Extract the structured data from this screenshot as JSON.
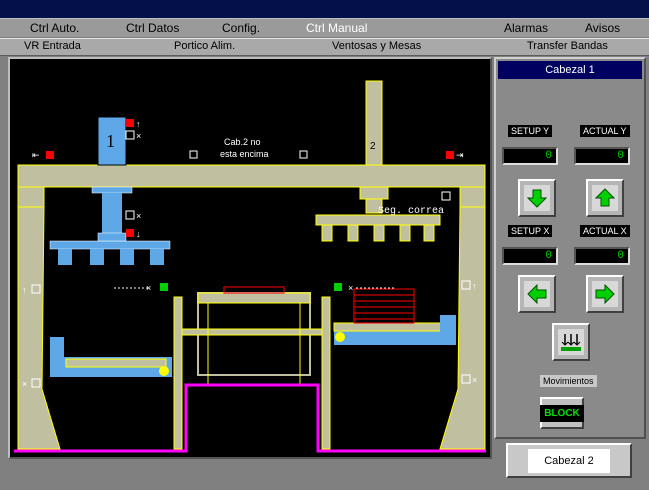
{
  "menu": {
    "items": [
      "Ctrl Auto.",
      "Ctrl Datos",
      "Config.",
      "Ctrl Manual",
      "Alarmas",
      "Avisos"
    ]
  },
  "submenu": {
    "items": [
      "VR  Entrada",
      "Portico  Alim.",
      "Ventosas y Mesas",
      "Transfer Bandas"
    ]
  },
  "canvas": {
    "head1_number": "1",
    "head2_number": "2",
    "message_line1": "Cab.2 no",
    "message_line2": "esta encima",
    "belt_label": "Seg. correa"
  },
  "panel": {
    "title": "Cabezal 1",
    "setup_y_label": "SETUP Y",
    "actual_y_label": "ACTUAL Y",
    "setup_y_value": "0",
    "actual_y_value": "0",
    "setup_x_label": "SETUP X",
    "actual_x_label": "ACTUAL X",
    "setup_x_value": "0",
    "actual_x_value": "0",
    "movements_label": "Movimientos",
    "block_label": "BLOCK"
  },
  "footer": {
    "cabezal2_label": "Cabezal 2"
  },
  "colors": {
    "structure": "#c0c0a0",
    "outline": "#ffff00",
    "head": "#5fa8e8",
    "pit": "#ff00ff",
    "arrow": "#00d000",
    "indicator_red": "#ff0000"
  }
}
